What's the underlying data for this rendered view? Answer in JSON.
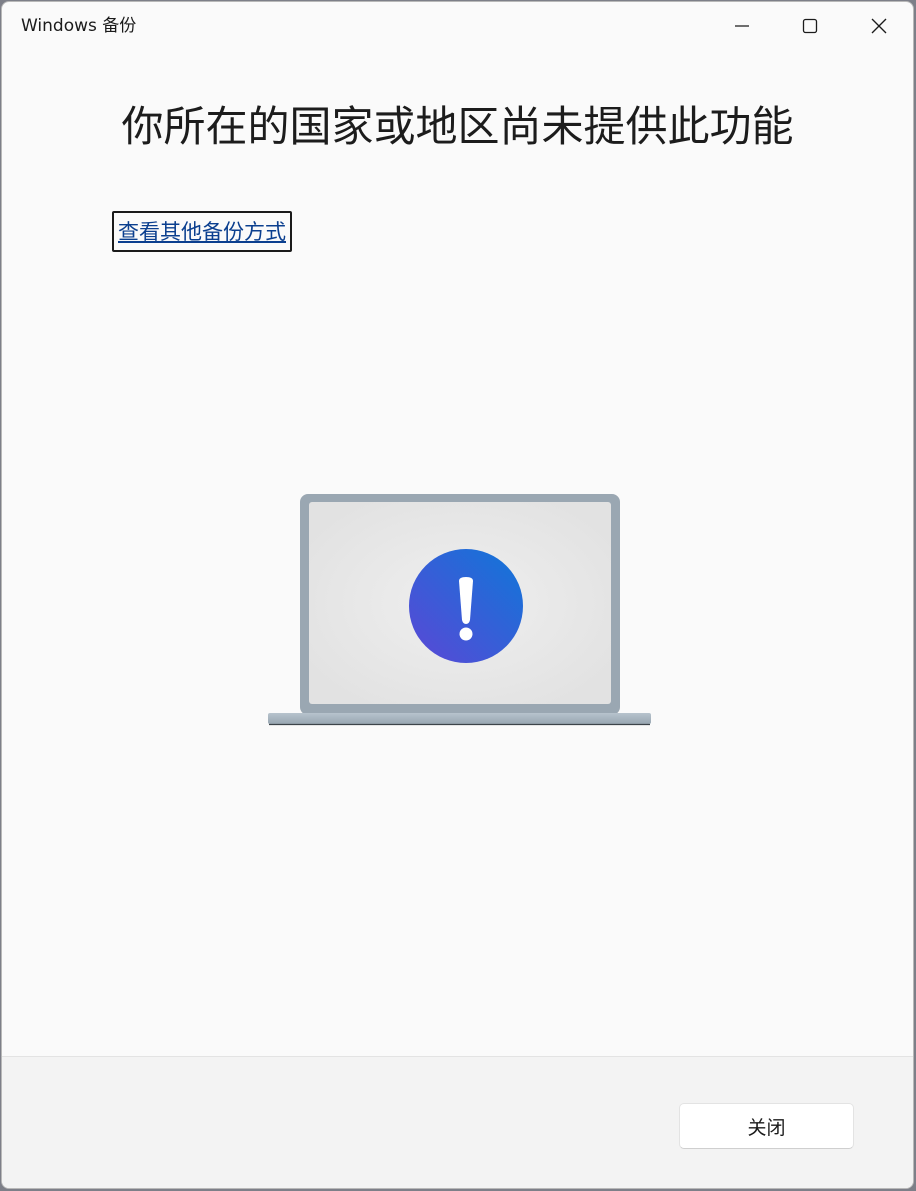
{
  "window": {
    "title": "Windows 备份",
    "controls": {
      "minimize_icon": "minimize-icon",
      "maximize_icon": "maximize-icon",
      "close_icon": "close-icon"
    }
  },
  "main": {
    "heading": "你所在的国家或地区尚未提供此功能",
    "link_label": "查看其他备份方式",
    "illustration": {
      "name": "laptop-alert-illustration",
      "badge_icon": "exclamation-icon",
      "badge_gradient": [
        "#5b47d6",
        "#0f77d8"
      ],
      "laptop_frame_color": "#9aa7b2",
      "screen_color": "#e6e6e6"
    }
  },
  "footer": {
    "close_button_label": "关闭"
  },
  "colors": {
    "window_bg": "#fafafa",
    "footer_bg": "#f3f3f3",
    "link": "#0b3f8f",
    "text": "#1c1c1c"
  }
}
